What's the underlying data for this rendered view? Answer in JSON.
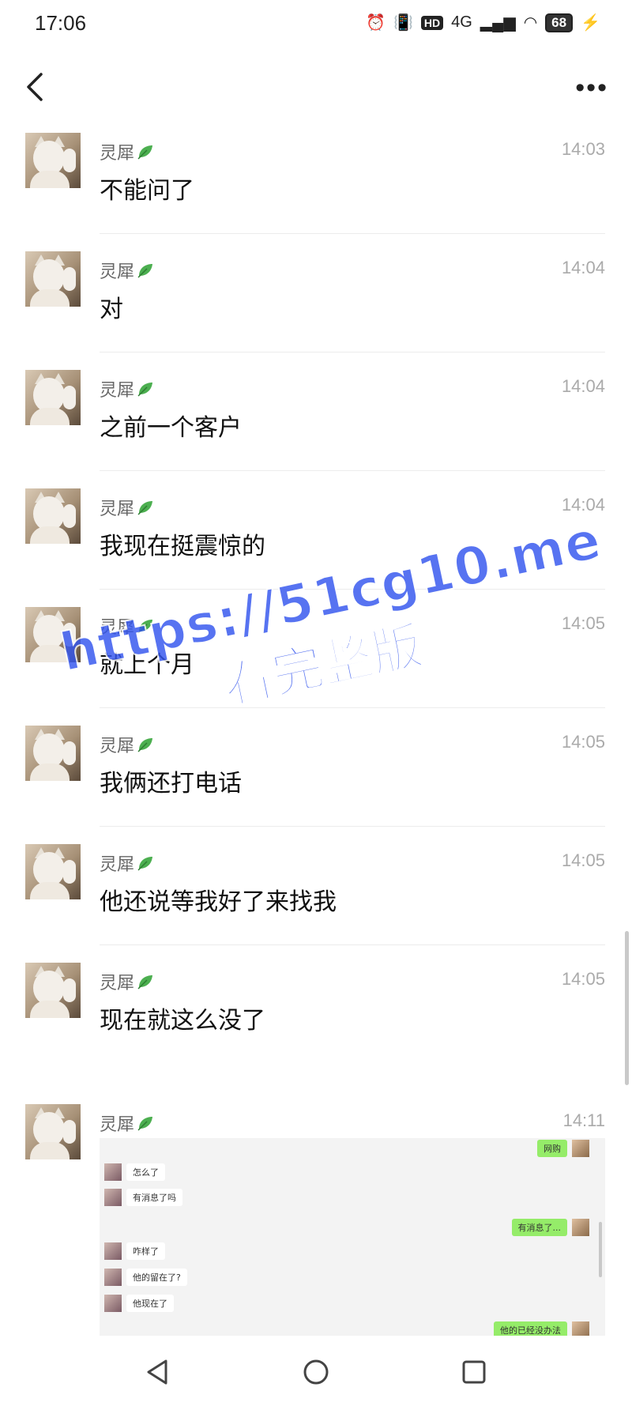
{
  "status_bar": {
    "time": "17:06",
    "network": "4G",
    "hd": "HD",
    "battery": "68"
  },
  "contact_name": "灵犀",
  "messages": [
    {
      "time": "14:03",
      "text": "不能问了"
    },
    {
      "time": "14:04",
      "text": "对"
    },
    {
      "time": "14:04",
      "text": "之前一个客户"
    },
    {
      "time": "14:04",
      "text": "我现在挺震惊的"
    },
    {
      "time": "14:05",
      "text": "就上个月"
    },
    {
      "time": "14:05",
      "text": "我俩还打电话"
    },
    {
      "time": "14:05",
      "text": "他还说等我好了来找我"
    },
    {
      "time": "14:05",
      "text": "现在就这么没了"
    },
    {
      "time": "14:11",
      "text": ""
    }
  ],
  "screenshot_chat": [
    {
      "side": "right",
      "text": "网购"
    },
    {
      "side": "left",
      "text": "怎么了"
    },
    {
      "side": "left",
      "text": "有消息了吗"
    },
    {
      "side": "right",
      "text": "有消息了..."
    },
    {
      "side": "left",
      "text": "咋样了"
    },
    {
      "side": "left",
      "text": "他的留在了?"
    },
    {
      "side": "left",
      "text": "他现在了"
    },
    {
      "side": "right",
      "text": "他的已经没办法"
    }
  ],
  "watermark": {
    "url": "https://51cg10.me",
    "caption": "看完整版"
  },
  "icons": {
    "back": "back-arrow-icon",
    "more": "more-dots-icon",
    "leaf": "leaf-icon",
    "nav_back": "triangle-back-icon",
    "nav_home": "circle-home-icon",
    "nav_recent": "square-recent-icon"
  },
  "colors": {
    "watermark": "#3355ee",
    "sent_bubble": "#95ec69",
    "leaf": "#4caf50"
  }
}
